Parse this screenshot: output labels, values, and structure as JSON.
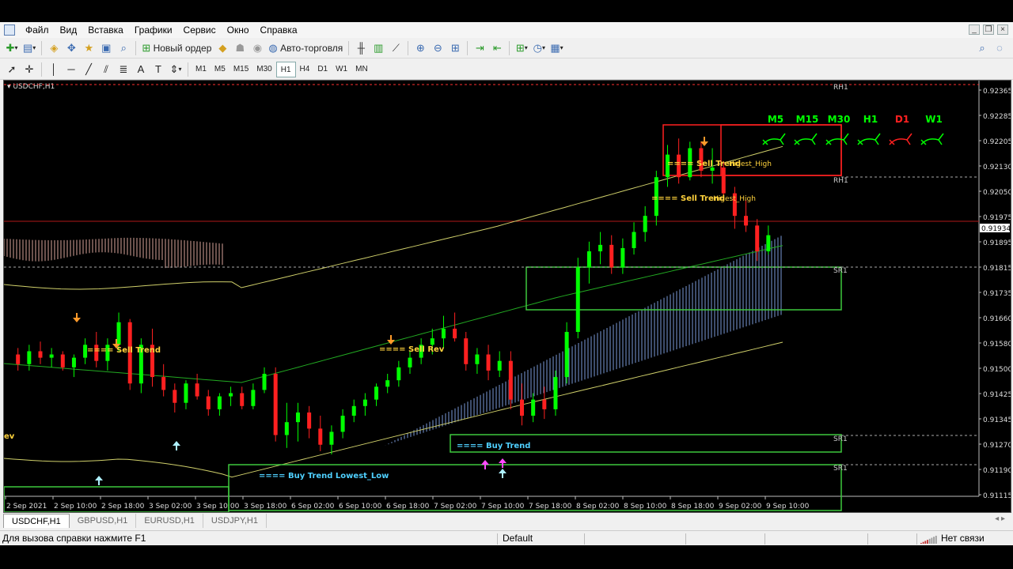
{
  "menu": [
    "Файл",
    "Вид",
    "Вставка",
    "Графики",
    "Сервис",
    "Окно",
    "Справка"
  ],
  "toolbar": {
    "new_order": "Новый ордер",
    "auto_trading": "Авто-торговля",
    "timeframes": [
      "M1",
      "M5",
      "M15",
      "M30",
      "H1",
      "H4",
      "D1",
      "W1",
      "MN"
    ],
    "active_timeframe": "H1"
  },
  "chart": {
    "symbol_label": "USDCHF,H1",
    "current_price": "0.91934",
    "price_ticks": [
      "0.92365",
      "0.92285",
      "0.92205",
      "0.92130",
      "0.92050",
      "0.91975",
      "0.91895",
      "0.91815",
      "0.91735",
      "0.91660",
      "0.91580",
      "0.91500",
      "0.91425",
      "0.91345",
      "0.91270",
      "0.91190",
      "0.91115"
    ],
    "time_ticks": [
      "2 Sep 2021",
      "2 Sep 10:00",
      "2 Sep 18:00",
      "3 Sep 02:00",
      "3 Sep 10:00",
      "3 Sep 18:00",
      "6 Sep 02:00",
      "6 Sep 10:00",
      "6 Sep 18:00",
      "7 Sep 02:00",
      "7 Sep 10:00",
      "7 Sep 18:00",
      "8 Sep 02:00",
      "8 Sep 10:00",
      "8 Sep 18:00",
      "9 Sep 02:00",
      "9 Sep 10:00"
    ],
    "mtf_labels": [
      "M5",
      "M15",
      "M30",
      "H1",
      "D1",
      "W1"
    ],
    "mtf_colors": [
      "#00ff00",
      "#00ff00",
      "#00ff00",
      "#00ff00",
      "#ff2020",
      "#00ff00"
    ],
    "annotations": {
      "sell_trend_left": "Sell Trend",
      "sell_rev": "Sell Rev",
      "rev": "ev",
      "sell_trend_top": "Sell Trend",
      "higest_high_top": "Higest_High",
      "sell_trend_mid": "Sell Trend",
      "higest_high_mid": "Higest_High",
      "buy_trend": "Buy Trend",
      "buy_trend_lowest": "Buy Trend Lowest_Low"
    },
    "level_labels": {
      "rh1": "RH1",
      "rh1b": "RH1",
      "sr1": "SR1",
      "sr1b": "SR1",
      "sr1c": "SR1"
    },
    "colors": {
      "bull": "#00ff00",
      "bear": "#ff2020",
      "sell_box": "#ff2020",
      "buy_box": "#3ec83e",
      "ma": "#cfcf6a",
      "ma_green": "#22aa22",
      "cloud_up": "#7a9ad8",
      "cloud_down": "#d7a59a"
    }
  },
  "chart_data": {
    "type": "candlestick",
    "symbol": "USDCHF",
    "timeframe": "H1",
    "ylim": [
      0.9111,
      0.9238
    ],
    "candles": [
      [
        0.9155,
        0.9157,
        0.915,
        0.9152
      ],
      [
        0.9152,
        0.9158,
        0.915,
        0.9156
      ],
      [
        0.9156,
        0.9159,
        0.9152,
        0.9154
      ],
      [
        0.9154,
        0.9157,
        0.9151,
        0.9155
      ],
      [
        0.9155,
        0.9156,
        0.915,
        0.9151
      ],
      [
        0.9151,
        0.9155,
        0.9148,
        0.9154
      ],
      [
        0.9154,
        0.916,
        0.9152,
        0.9158
      ],
      [
        0.9158,
        0.9162,
        0.9151,
        0.9153
      ],
      [
        0.9153,
        0.916,
        0.915,
        0.9158
      ],
      [
        0.9158,
        0.9168,
        0.9156,
        0.9165
      ],
      [
        0.9165,
        0.9166,
        0.9144,
        0.9146
      ],
      [
        0.9146,
        0.916,
        0.9143,
        0.9158
      ],
      [
        0.9158,
        0.9163,
        0.9145,
        0.9148
      ],
      [
        0.9148,
        0.9152,
        0.9142,
        0.9144
      ],
      [
        0.9144,
        0.9146,
        0.9137,
        0.914
      ],
      [
        0.914,
        0.9147,
        0.9138,
        0.9146
      ],
      [
        0.9146,
        0.9149,
        0.9141,
        0.9142
      ],
      [
        0.9142,
        0.9144,
        0.9136,
        0.9138
      ],
      [
        0.9138,
        0.9143,
        0.9136,
        0.9142
      ],
      [
        0.9142,
        0.9145,
        0.9139,
        0.9143
      ],
      [
        0.9143,
        0.9145,
        0.9138,
        0.9139
      ],
      [
        0.9139,
        0.9146,
        0.9138,
        0.9144
      ],
      [
        0.9144,
        0.9151,
        0.9143,
        0.9149
      ],
      [
        0.9149,
        0.9151,
        0.9128,
        0.913
      ],
      [
        0.913,
        0.914,
        0.9126,
        0.9134
      ],
      [
        0.9134,
        0.914,
        0.9128,
        0.9137
      ],
      [
        0.9137,
        0.9139,
        0.9129,
        0.9132
      ],
      [
        0.9132,
        0.9136,
        0.9125,
        0.9127
      ],
      [
        0.9127,
        0.9133,
        0.9124,
        0.9131
      ],
      [
        0.9131,
        0.9138,
        0.9129,
        0.9136
      ],
      [
        0.9136,
        0.9141,
        0.9134,
        0.9139
      ],
      [
        0.9139,
        0.9143,
        0.9136,
        0.9141
      ],
      [
        0.9141,
        0.9146,
        0.9139,
        0.9145
      ],
      [
        0.9145,
        0.9149,
        0.9143,
        0.9147
      ],
      [
        0.9147,
        0.9153,
        0.9145,
        0.9151
      ],
      [
        0.9151,
        0.9156,
        0.9149,
        0.9154
      ],
      [
        0.9154,
        0.916,
        0.9152,
        0.9158
      ],
      [
        0.9158,
        0.9163,
        0.9155,
        0.916
      ],
      [
        0.916,
        0.9167,
        0.9157,
        0.9163
      ],
      [
        0.9163,
        0.9168,
        0.9159,
        0.916
      ],
      [
        0.916,
        0.9162,
        0.915,
        0.9152
      ],
      [
        0.9152,
        0.9157,
        0.9149,
        0.9155
      ],
      [
        0.9155,
        0.9158,
        0.9147,
        0.915
      ],
      [
        0.915,
        0.9156,
        0.9148,
        0.9153
      ],
      [
        0.9153,
        0.9156,
        0.9138,
        0.9141
      ],
      [
        0.9141,
        0.9146,
        0.9133,
        0.9136
      ],
      [
        0.9136,
        0.9143,
        0.9134,
        0.9141
      ],
      [
        0.9141,
        0.9145,
        0.9135,
        0.9138
      ],
      [
        0.9138,
        0.915,
        0.9136,
        0.9148
      ],
      [
        0.9148,
        0.9165,
        0.9146,
        0.9162
      ],
      [
        0.9162,
        0.9185,
        0.916,
        0.9182
      ],
      [
        0.9182,
        0.919,
        0.9177,
        0.9187
      ],
      [
        0.9187,
        0.9193,
        0.9183,
        0.9189
      ],
      [
        0.9189,
        0.9192,
        0.918,
        0.9182
      ],
      [
        0.9182,
        0.9191,
        0.918,
        0.9188
      ],
      [
        0.9188,
        0.9196,
        0.9186,
        0.9193
      ],
      [
        0.9193,
        0.9201,
        0.919,
        0.9198
      ],
      [
        0.9198,
        0.9212,
        0.9195,
        0.921
      ],
      [
        0.921,
        0.922,
        0.9207,
        0.9217
      ],
      [
        0.9217,
        0.9222,
        0.9208,
        0.921
      ],
      [
        0.921,
        0.9221,
        0.9209,
        0.9219
      ],
      [
        0.9219,
        0.9221,
        0.921,
        0.9212
      ],
      [
        0.9212,
        0.9219,
        0.9208,
        0.9213
      ],
      [
        0.9213,
        0.9215,
        0.9203,
        0.9205
      ],
      [
        0.9205,
        0.9207,
        0.9194,
        0.9198
      ],
      [
        0.9198,
        0.9203,
        0.9193,
        0.9195
      ],
      [
        0.9195,
        0.9197,
        0.9184,
        0.9187
      ],
      [
        0.9187,
        0.9195,
        0.9186,
        0.9192
      ]
    ],
    "levels": [
      {
        "name": "RH1",
        "value": 0.9236
      },
      {
        "name": "RH1",
        "value": 0.9217
      },
      {
        "name": "SR1",
        "value": 0.9189
      },
      {
        "name": "SR1",
        "value": 0.9136
      },
      {
        "name": "SR1",
        "value": 0.9127
      }
    ],
    "current_price": 0.91934
  }
}
